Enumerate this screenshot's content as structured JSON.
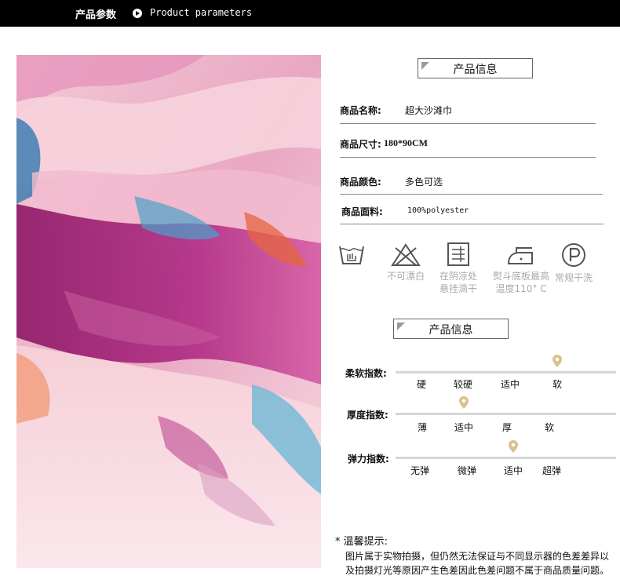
{
  "header": {
    "title_zh": "产品参数",
    "title_en": "Product parameters"
  },
  "info_section": {
    "title": "产品信息"
  },
  "fields": [
    {
      "label": "商品名称:",
      "value": "超大沙滩巾"
    },
    {
      "label": "商品尺寸:",
      "value": "180*90CM"
    },
    {
      "label": "商品颜色:",
      "value": "多色可选"
    },
    {
      "label": "商品面料:",
      "value": "100%polyester"
    }
  ],
  "care_icons": [
    {
      "icon": "hand-wash-icon",
      "line1": "",
      "line2": ""
    },
    {
      "icon": "no-bleach-icon",
      "line1": "不可漂白",
      "line2": ""
    },
    {
      "icon": "hang-dry-shade-icon",
      "line1": "在阴凉处",
      "line2": "悬挂滴干"
    },
    {
      "icon": "iron-icon",
      "line1": "熨斗底板最高",
      "line2": "温度110° C"
    },
    {
      "icon": "dry-clean-icon",
      "line1": "常规干洗",
      "line2": ""
    }
  ],
  "index_section": {
    "title": "产品信息"
  },
  "scales": [
    {
      "label": "柔软指数:",
      "ticks": [
        "硬",
        "较硬",
        "适中",
        "软"
      ],
      "selected_index": 3
    },
    {
      "label": "厚度指数:",
      "ticks": [
        "薄",
        "适中",
        "厚",
        "软"
      ],
      "selected_index": 1
    },
    {
      "label": "弹力指数:",
      "ticks": [
        "无弹",
        "微弹",
        "适中",
        "超弹"
      ],
      "selected_index": 2
    }
  ],
  "note": {
    "heading": "* 温馨提示:",
    "line1": "图片属于实物拍摄，但仍然无法保证与不同显示器的色差差异以",
    "line2": "及拍摄灯光等原因产生色差因此色差问题不属于商品质量问题。"
  },
  "colors": {
    "header_bg": "#000000",
    "pin": "#d9c18c",
    "scale_bar": "#d6d6d6"
  }
}
